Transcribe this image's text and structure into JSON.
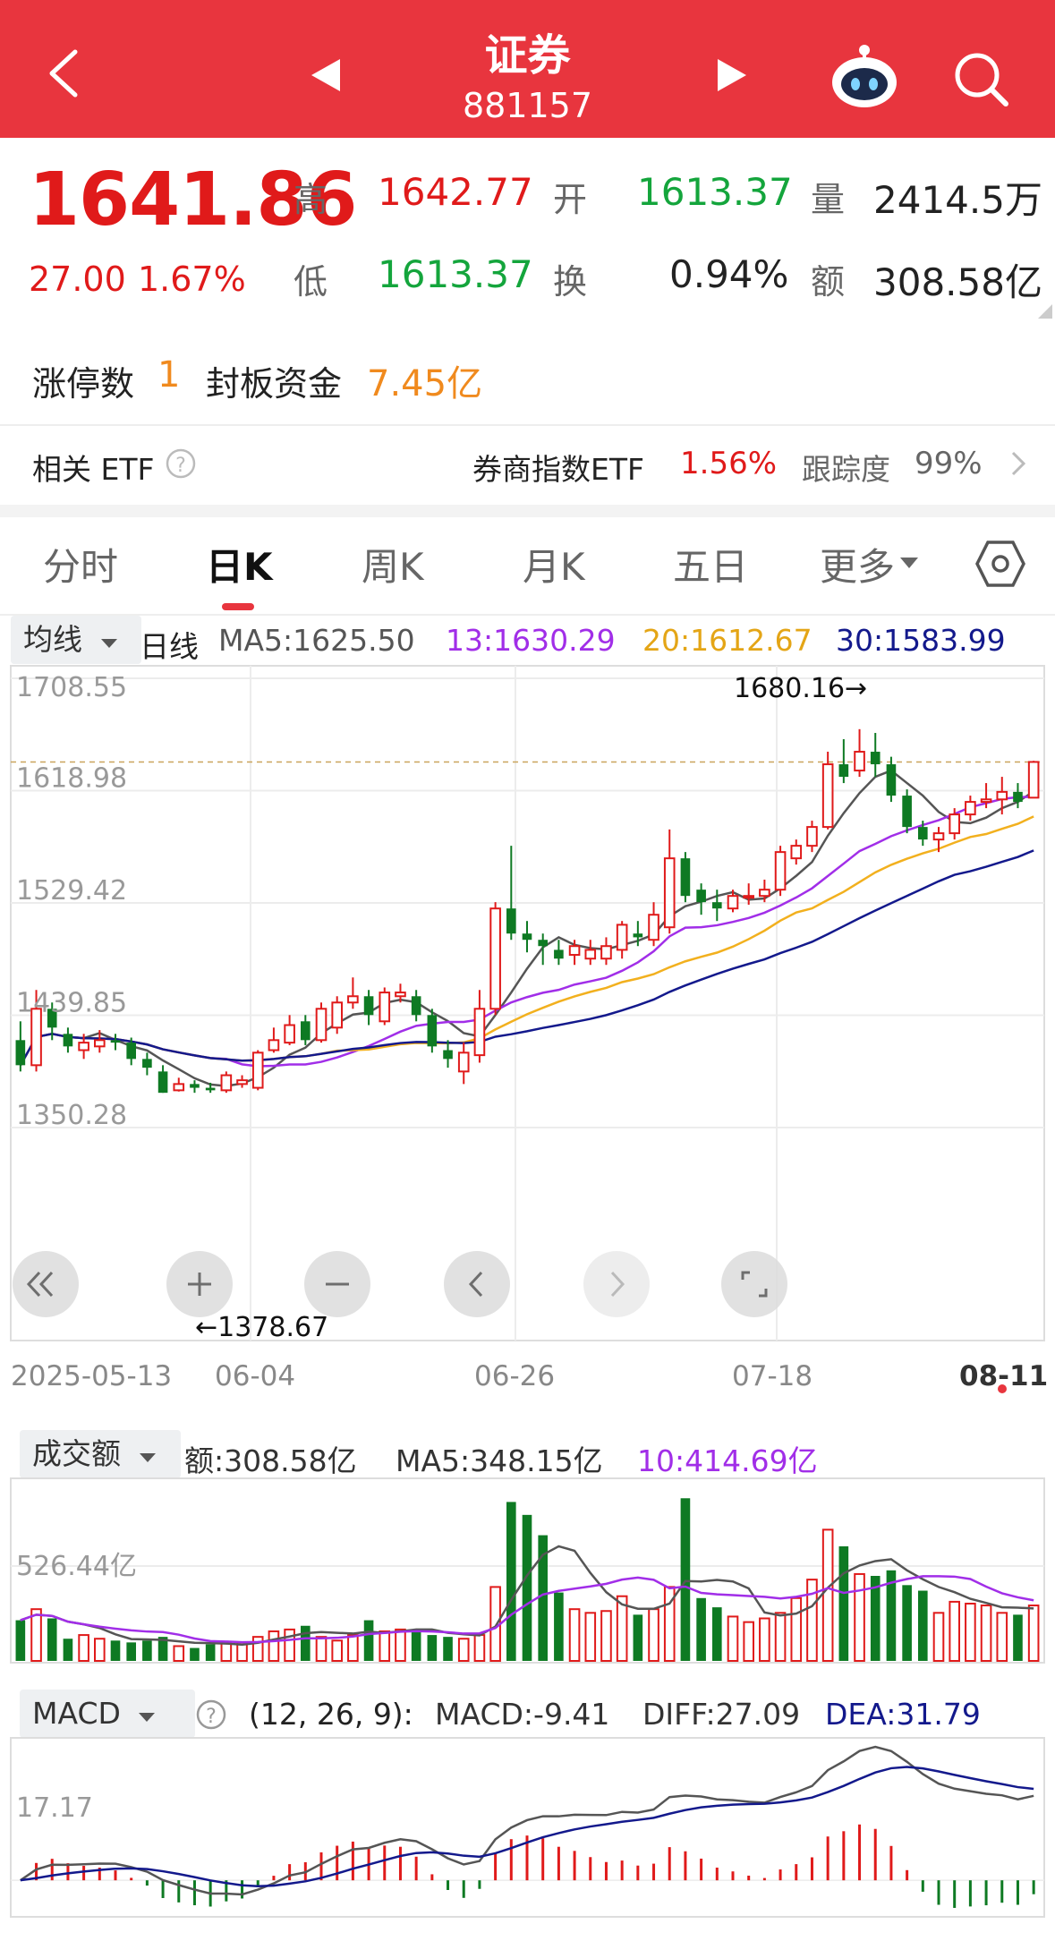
{
  "header": {
    "title": "证券",
    "code": "881157"
  },
  "quote": {
    "price": "1641.86",
    "change": "27.00",
    "change_pct": "1.67%",
    "high_label": "高",
    "high": "1642.77",
    "open_label": "开",
    "open": "1613.37",
    "vol_label": "量",
    "vol": "2414.5万",
    "low_label": "低",
    "low": "1613.37",
    "turnover_label": "换",
    "turnover": "0.94%",
    "amount_label": "额",
    "amount": "308.58亿"
  },
  "limit": {
    "count_label": "涨停数",
    "count": "1",
    "fund_label": "封板资金",
    "fund": "7.45亿"
  },
  "etf": {
    "label": "相关 ETF",
    "name": "券商指数ETF",
    "pct": "1.56%",
    "track_label": "跟踪度",
    "track": "99%"
  },
  "tabs": [
    "分时",
    "日K",
    "周K",
    "月K",
    "五日",
    "更多"
  ],
  "ma_bar": {
    "select": "均线",
    "period": "日线",
    "ma5": "MA5:1625.50",
    "ma13": "13:1630.29",
    "ma20": "20:1612.67",
    "ma30": "30:1583.99"
  },
  "colors": {
    "up": "#e01a1a",
    "down": "#0e7a23",
    "ma5": "#555555",
    "ma13": "#a12ee8",
    "ma20": "#f2b01e",
    "ma30": "#13198c"
  },
  "chart_data": [
    {
      "type": "candlestick",
      "title": "日K",
      "y_ticks": [
        "1708.55",
        "1618.98",
        "1529.42",
        "1439.85",
        "1350.28"
      ],
      "x_ticks": [
        "2025-05-13",
        "06-04",
        "06-26",
        "07-18",
        "08-11"
      ],
      "ylim": [
        1350.28,
        1708.55
      ],
      "annotations": [
        "1680.16→",
        "←1378.67"
      ],
      "candles": [
        [
          1420,
          1400,
          1435,
          1395
        ],
        [
          1400,
          1445,
          1460,
          1395
        ],
        [
          1445,
          1430,
          1450,
          1420
        ],
        [
          1425,
          1415,
          1430,
          1410
        ],
        [
          1412,
          1418,
          1425,
          1405
        ],
        [
          1415,
          1420,
          1428,
          1410
        ],
        [
          1420,
          1418,
          1425,
          1412
        ],
        [
          1418,
          1405,
          1422,
          1400
        ],
        [
          1405,
          1398,
          1410,
          1392
        ],
        [
          1395,
          1378,
          1400,
          1378
        ],
        [
          1380,
          1385,
          1390,
          1379
        ],
        [
          1385,
          1382,
          1388,
          1378
        ],
        [
          1382,
          1380,
          1386,
          1378
        ],
        [
          1380,
          1392,
          1395,
          1378
        ],
        [
          1385,
          1388,
          1392,
          1382
        ],
        [
          1382,
          1410,
          1412,
          1380
        ],
        [
          1412,
          1420,
          1430,
          1410
        ],
        [
          1418,
          1432,
          1440,
          1416
        ],
        [
          1435,
          1420,
          1440,
          1416
        ],
        [
          1420,
          1445,
          1450,
          1418
        ],
        [
          1430,
          1450,
          1455,
          1425
        ],
        [
          1450,
          1455,
          1470,
          1445
        ],
        [
          1455,
          1440,
          1460,
          1432
        ],
        [
          1435,
          1458,
          1462,
          1432
        ],
        [
          1455,
          1458,
          1465,
          1450
        ],
        [
          1455,
          1440,
          1460,
          1435
        ],
        [
          1440,
          1415,
          1445,
          1410
        ],
        [
          1412,
          1405,
          1420,
          1398
        ],
        [
          1395,
          1410,
          1418,
          1385
        ],
        [
          1408,
          1445,
          1460,
          1402
        ],
        [
          1445,
          1525,
          1530,
          1440
        ],
        [
          1525,
          1505,
          1575,
          1500
        ],
        [
          1505,
          1500,
          1515,
          1490
        ],
        [
          1500,
          1495,
          1505,
          1480
        ],
        [
          1492,
          1485,
          1500,
          1480
        ],
        [
          1488,
          1495,
          1500,
          1480
        ],
        [
          1485,
          1492,
          1500,
          1480
        ],
        [
          1485,
          1495,
          1502,
          1480
        ],
        [
          1492,
          1512,
          1515,
          1485
        ],
        [
          1505,
          1502,
          1515,
          1495
        ],
        [
          1500,
          1520,
          1530,
          1495
        ],
        [
          1510,
          1565,
          1588,
          1505
        ],
        [
          1565,
          1535,
          1570,
          1530
        ],
        [
          1540,
          1530,
          1545,
          1520
        ],
        [
          1530,
          1525,
          1540,
          1515
        ],
        [
          1525,
          1535,
          1540,
          1522
        ],
        [
          1535,
          1535,
          1545,
          1528
        ],
        [
          1535,
          1540,
          1548,
          1530
        ],
        [
          1540,
          1570,
          1575,
          1535
        ],
        [
          1565,
          1575,
          1580,
          1560
        ],
        [
          1575,
          1590,
          1595,
          1570
        ],
        [
          1590,
          1640,
          1650,
          1588
        ],
        [
          1640,
          1630,
          1660,
          1625
        ],
        [
          1635,
          1650,
          1668,
          1630
        ],
        [
          1650,
          1640,
          1665,
          1630
        ],
        [
          1640,
          1615,
          1646,
          1610
        ],
        [
          1615,
          1590,
          1620,
          1585
        ],
        [
          1590,
          1580,
          1595,
          1575
        ],
        [
          1580,
          1585,
          1590,
          1570
        ],
        [
          1585,
          1600,
          1605,
          1580
        ],
        [
          1600,
          1610,
          1615,
          1595
        ],
        [
          1610,
          1612,
          1625,
          1605
        ],
        [
          1612,
          1618,
          1630,
          1600
        ],
        [
          1618,
          1610,
          1625,
          1605
        ],
        [
          1613.37,
          1641.86,
          1642.77,
          1613.37
        ]
      ],
      "ma_legend": [
        "MA5:1625.50",
        "13:1630.29",
        "20:1612.67",
        "30:1583.99"
      ]
    },
    {
      "type": "bar",
      "title": "成交额",
      "labels": [
        "额:308.58亿",
        "MA5:348.15亿",
        "10:414.69亿"
      ],
      "y_tick": "526.44亿",
      "values": [
        2.2,
        2.8,
        2.3,
        1.2,
        1.4,
        1.2,
        1.1,
        1.0,
        1.1,
        1.3,
        0.8,
        0.7,
        0.9,
        1.0,
        1.0,
        1.3,
        1.6,
        1.7,
        1.9,
        1.3,
        1.1,
        1.4,
        2.2,
        1.6,
        1.7,
        1.6,
        1.4,
        1.3,
        1.2,
        1.4,
        4.0,
        8.6,
        7.9,
        6.8,
        3.7,
        2.8,
        2.6,
        2.7,
        3.5,
        2.5,
        2.8,
        4.0,
        8.8,
        3.4,
        2.9,
        2.4,
        2.1,
        2.3,
        2.6,
        3.4,
        4.4,
        7.1,
        6.2,
        4.7,
        4.6,
        4.9,
        4.1,
        3.8,
        2.6,
        3.2,
        3.1,
        3.0,
        2.6,
        2.5,
        3.0
      ]
    },
    {
      "type": "line",
      "title": "MACD",
      "params": "(12, 26, 9):",
      "labels": [
        "MACD:-9.41",
        "DIFF:27.09",
        "DEA:31.79"
      ],
      "y_tick": "17.17"
    }
  ],
  "controls": [
    "rewind",
    "zoom-in",
    "zoom-out",
    "prev",
    "next",
    "fullscreen"
  ]
}
